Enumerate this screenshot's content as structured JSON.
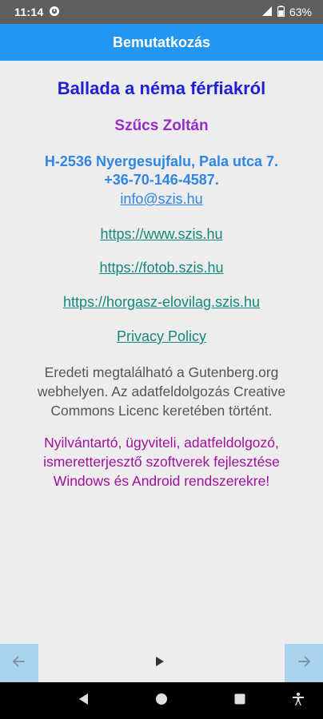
{
  "status_bar": {
    "time": "11:14",
    "battery": "63%"
  },
  "app_bar": {
    "title": "Bemutatkozás"
  },
  "content": {
    "book_title": "Ballada a néma férfiakról",
    "author": "Szűcs Zoltán",
    "address": "H-2536 Nyergesujfalu, Pala utca 7.",
    "phone": "+36-70-146-4587.",
    "email": "info@szis.hu",
    "links": [
      "https://www.szis.hu",
      "https://fotob.szis.hu",
      "https://horgasz-elovilag.szis.hu"
    ],
    "privacy": "Privacy Policy",
    "note_lines": [
      "Eredeti megtalálható a Gutenberg.org",
      "webhelyen. Az adatfeldolgozás Creative",
      "Commons Licenc keretében történt."
    ],
    "promo_lines": [
      "Nyilvántartó, ügyviteli, adatfeldolgozó,",
      "ismeretterjesztő szoftverek fejlesztése",
      "Windows és Android rendszerekre!"
    ]
  },
  "colors": {
    "app_bar": "#2196f3",
    "title": "#1f1fd6",
    "author": "#9a2bc8",
    "contact": "#2f86e6",
    "link": "#14897b",
    "note": "#555555",
    "promo": "#a0109c",
    "nav_button": "#a9d3ee"
  },
  "icons": {
    "status": [
      "notification-icon",
      "signal-icon",
      "battery-icon"
    ],
    "bottom_nav": [
      "arrow-left-icon",
      "play-icon",
      "arrow-right-icon"
    ],
    "system": [
      "back-icon",
      "home-icon",
      "recents-icon",
      "accessibility-icon"
    ]
  }
}
